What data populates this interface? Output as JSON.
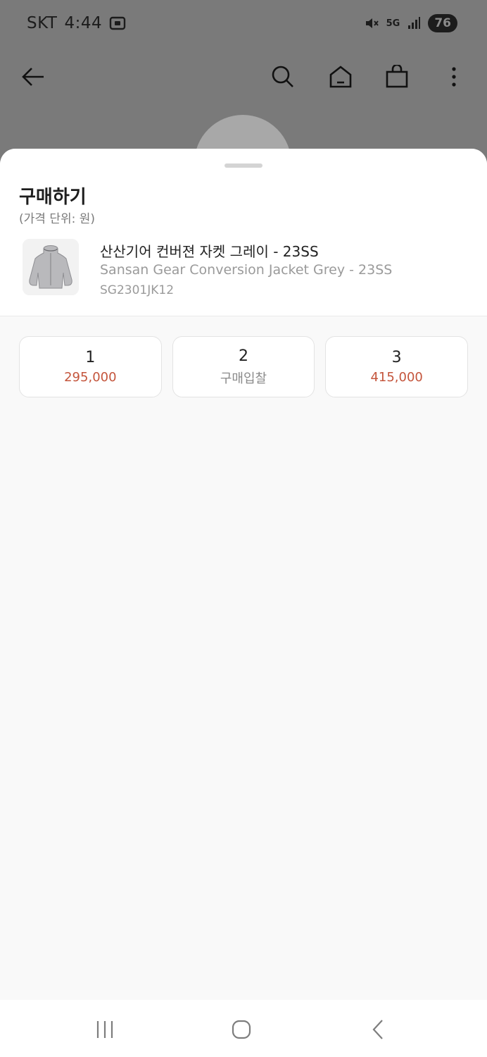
{
  "status_bar": {
    "carrier": "SKT",
    "time": "4:44",
    "network": "5G",
    "battery": "76"
  },
  "header": {
    "icons": [
      "back-arrow-icon",
      "search-icon",
      "home-icon",
      "shopping-bag-icon",
      "more-vertical-icon"
    ]
  },
  "sheet": {
    "title": "구매하기",
    "subtitle": "(가격 단위: 원)",
    "product": {
      "name_ko": "산산기어 컨버젼 자켓 그레이 - 23SS",
      "name_en": "Sansan Gear Conversion Jacket Grey - 23SS",
      "code": "SG2301JK12"
    },
    "sizes": [
      {
        "label": "1",
        "price": "295,000"
      },
      {
        "label": "2",
        "price": "구매입찰"
      },
      {
        "label": "3",
        "price": "415,000"
      }
    ]
  },
  "colors": {
    "price_accent": "#c4553c",
    "sheet_bg": "#f9f9f9",
    "dim_overlay": "#7a7a7a"
  },
  "nav_bar": {
    "icons": [
      "recent-apps-icon",
      "home-circle-icon",
      "back-chevron-icon"
    ]
  }
}
